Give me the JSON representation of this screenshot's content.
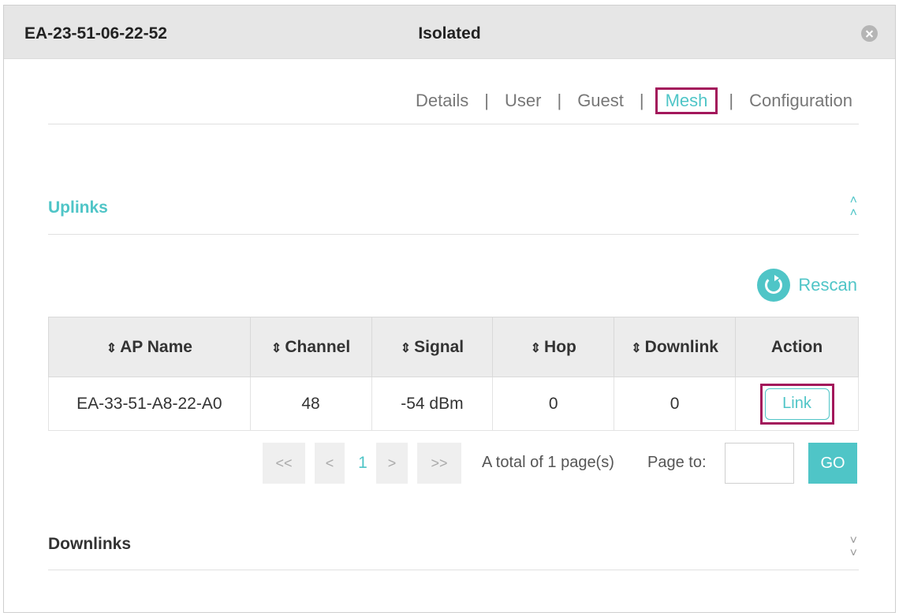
{
  "header": {
    "device_name": "EA-23-51-06-22-52",
    "status": "Isolated"
  },
  "tabs": [
    {
      "label": "Details"
    },
    {
      "label": "User"
    },
    {
      "label": "Guest"
    },
    {
      "label": "Mesh",
      "active": true
    },
    {
      "label": "Configuration"
    }
  ],
  "tab_separator": "|",
  "uplinks": {
    "title": "Uplinks",
    "toggle_icon": "double-chevron-up-icon",
    "rescan_label": "Rescan",
    "columns": [
      {
        "label": "AP Name",
        "sortable": true
      },
      {
        "label": "Channel",
        "sortable": true
      },
      {
        "label": "Signal",
        "sortable": true
      },
      {
        "label": "Hop",
        "sortable": true
      },
      {
        "label": "Downlink",
        "sortable": true
      },
      {
        "label": "Action",
        "sortable": false
      }
    ],
    "rows": [
      {
        "ap_name": "EA-33-51-A8-22-A0",
        "channel": "48",
        "signal": "-54 dBm",
        "hop": "0",
        "downlink": "0",
        "action": "Link"
      }
    ]
  },
  "pagination": {
    "first": "<<",
    "prev": "<",
    "current_page": "1",
    "next": ">",
    "last": ">>",
    "total_text": "A total of 1 page(s)",
    "page_to_label": "Page to:",
    "page_input_value": "",
    "go_label": "GO"
  },
  "downlinks": {
    "title": "Downlinks",
    "toggle_icon": "double-chevron-down-icon"
  },
  "colors": {
    "accent": "#4fc5c7",
    "highlight_frame": "#a3175b",
    "header_bg": "#e6e6e6"
  }
}
